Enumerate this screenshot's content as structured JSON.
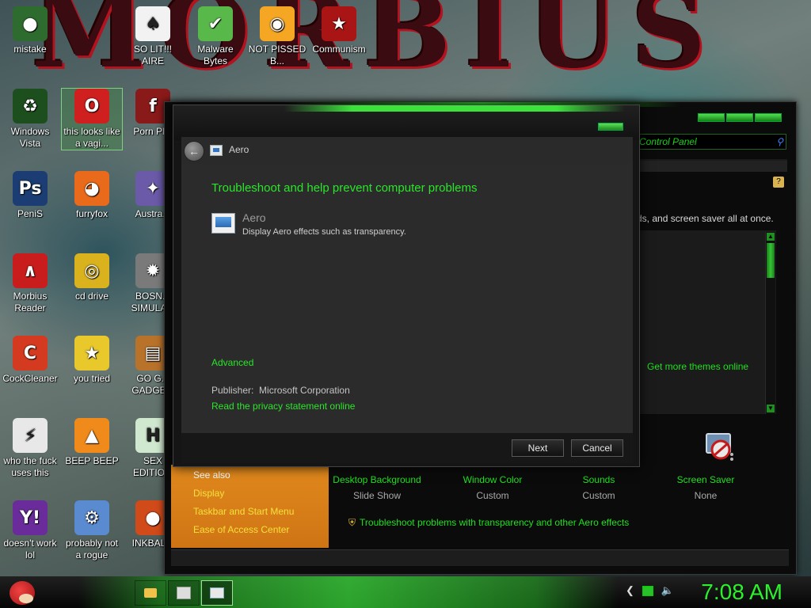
{
  "wallpaper": {
    "title_text": "MORBIUS"
  },
  "desktop_icons": [
    {
      "label": "mistake",
      "icon": "green-orb-icon",
      "color": "#2e6b2e",
      "glyph": "●"
    },
    {
      "label": "SO LIT!!! AIRE",
      "icon": "playing-card-icon",
      "color": "#f2f2f2",
      "glyph": "♠"
    },
    {
      "label": "Malware Bytes",
      "icon": "shield-check-icon",
      "color": "#58b84a",
      "glyph": "✔"
    },
    {
      "label": "NOT PISSED B...",
      "icon": "green-pig-icon",
      "color": "#f5a623",
      "glyph": "◉"
    },
    {
      "label": "Communism",
      "icon": "red-bird-emblem-icon",
      "color": "#a91515",
      "glyph": "★"
    },
    {
      "label": "Windows Vista",
      "icon": "recycle-icon",
      "color": "#1d4e1d",
      "glyph": "♻"
    },
    {
      "label": "this looks like a vagi...",
      "icon": "opera-icon",
      "color": "#d01f1f",
      "glyph": "O"
    },
    {
      "label": "Porn Pl...",
      "icon": "flash-player-icon",
      "color": "#8a1a1a",
      "glyph": "f"
    },
    {
      "label": "PeniS",
      "icon": "photoshop-icon",
      "color": "#1b3d73",
      "glyph": "Ps"
    },
    {
      "label": "furryfox",
      "icon": "firefox-icon",
      "color": "#e86a1a",
      "glyph": "◕"
    },
    {
      "label": "Austra...",
      "icon": "spider-solitaire-icon",
      "color": "#6a5aa8",
      "glyph": "✦"
    },
    {
      "label": "Morbius Reader",
      "icon": "pdf-reader-icon",
      "color": "#c91d1d",
      "glyph": "∧"
    },
    {
      "label": "cd drive",
      "icon": "cd-drive-icon",
      "color": "#d9b21d",
      "glyph": "◎"
    },
    {
      "label": "BOSN... SIMULA...",
      "icon": "gear-ball-icon",
      "color": "#7a7a7a",
      "glyph": "✹"
    },
    {
      "label": "CockCleaner",
      "icon": "ccleaner-icon",
      "color": "#d33a20",
      "glyph": "C"
    },
    {
      "label": "you tried",
      "icon": "star-icon",
      "color": "#e8c82a",
      "glyph": "★"
    },
    {
      "label": "GO G... GADGE...",
      "icon": "briefcase-icon",
      "color": "#b8722a",
      "glyph": "▤"
    },
    {
      "label": "who the fuck uses this",
      "icon": "lightning-icon",
      "color": "#e8e8e8",
      "glyph": "⚡"
    },
    {
      "label": "BEEP BEEP",
      "icon": "vlc-cone-icon",
      "color": "#f08a1a",
      "glyph": "▲"
    },
    {
      "label": "SEX EDITIO...",
      "icon": "hx-editor-icon",
      "color": "#cfe8cf",
      "glyph": "H"
    },
    {
      "label": "doesn't work lol",
      "icon": "yahoo-messenger-icon",
      "color": "#6a2c9a",
      "glyph": "Y!"
    },
    {
      "label": "probably not a rogue",
      "icon": "gears-monitor-icon",
      "color": "#5a8ad0",
      "glyph": "⚙"
    },
    {
      "label": "INKBAL...",
      "icon": "inkball-icon",
      "color": "#d04a1a",
      "glyph": "●"
    }
  ],
  "control_panel": {
    "search_text": "Control Panel",
    "description_text": "ds, and screen saver all at once.",
    "get_more_themes": "Get more themes online",
    "see_also_title": "See also",
    "see_also_items": [
      "Display",
      "Taskbar and Start Menu",
      "Ease of Access Center"
    ],
    "personalization": [
      {
        "label": "Desktop Background",
        "value": "Slide Show"
      },
      {
        "label": "Window Color",
        "value": "Custom"
      },
      {
        "label": "Sounds",
        "value": "Custom"
      },
      {
        "label": "Screen Saver",
        "value": "None"
      }
    ],
    "troubleshoot_link": "Troubleshoot problems with transparency and other Aero effects"
  },
  "aero_dialog": {
    "header_title": "Aero",
    "heading": "Troubleshoot and help prevent computer problems",
    "item_title": "Aero",
    "item_description": "Display Aero effects such as transparency.",
    "advanced_link": "Advanced",
    "publisher_label": "Publisher:",
    "publisher_value": "Microsoft Corporation",
    "privacy_link": "Read the privacy statement online",
    "next_label": "Next",
    "cancel_label": "Cancel"
  },
  "taskbar": {
    "clock": "7:08 AM"
  },
  "colors": {
    "accent_green": "#2be52b",
    "orange_panel": "#e0891d",
    "dark_bg": "#151515"
  }
}
